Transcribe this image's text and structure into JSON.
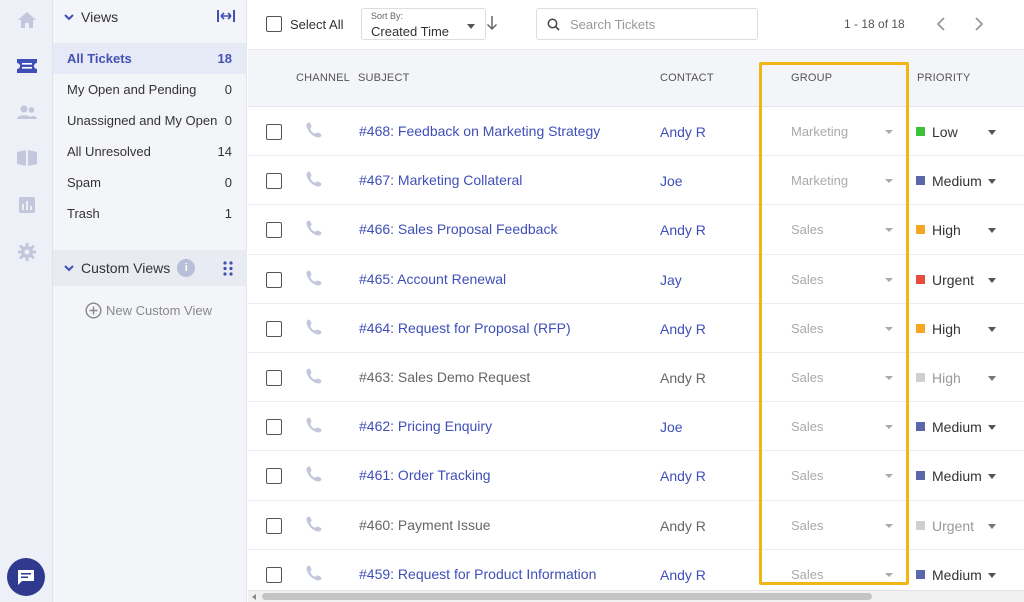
{
  "rail": {
    "icons": [
      "home-icon",
      "tickets-icon",
      "contacts-icon",
      "knowledge-base-icon",
      "reports-icon",
      "settings-icon"
    ],
    "active_icon": "tickets-icon",
    "active_color": "#3f4fb8",
    "inactive_color": "#c3c7dd",
    "chat_button_icon": "chat-icon"
  },
  "views": {
    "title": "Views",
    "items": [
      {
        "label": "All Tickets",
        "count": "18",
        "active": true
      },
      {
        "label": "My Open and Pending",
        "count": "0"
      },
      {
        "label": "Unassigned and My Open",
        "count": "0"
      },
      {
        "label": "All Unresolved",
        "count": "14"
      },
      {
        "label": "Spam",
        "count": "0"
      },
      {
        "label": "Trash",
        "count": "1"
      }
    ],
    "custom_views_title": "Custom Views",
    "info_badge": "i",
    "new_custom_view_label": "New Custom View"
  },
  "toolbar": {
    "select_all_label": "Select All",
    "sort_by_label": "Sort By:",
    "sort_value": "Created Time",
    "search_placeholder": "Search Tickets",
    "pagination": "1 - 18 of 18"
  },
  "table": {
    "columns": {
      "channel": "CHANNEL",
      "subject": "SUBJECT",
      "contact": "CONTACT",
      "group": "GROUP",
      "priority": "PRIORITY"
    },
    "rows": [
      {
        "subject": "#468: Feedback on Marketing Strategy",
        "contact": "Andy R",
        "group": "Marketing",
        "priority": "Low",
        "priority_color": "#3cc13b",
        "unread": true
      },
      {
        "subject": "#467: Marketing Collateral",
        "contact": "Joe",
        "group": "Marketing",
        "priority": "Medium",
        "priority_color": "#5b67a8",
        "unread": true
      },
      {
        "subject": "#466: Sales Proposal Feedback",
        "contact": "Andy R",
        "group": "Sales",
        "priority": "High",
        "priority_color": "#f5a623",
        "unread": true
      },
      {
        "subject": "#465: Account Renewal",
        "contact": "Jay",
        "group": "Sales",
        "priority": "Urgent",
        "priority_color": "#e84c3d",
        "unread": true
      },
      {
        "subject": "#464: Request for Proposal (RFP)",
        "contact": "Andy R",
        "group": "Sales",
        "priority": "High",
        "priority_color": "#f5a623",
        "unread": true
      },
      {
        "subject": "#463: Sales Demo Request",
        "contact": "Andy R",
        "group": "Sales",
        "priority": "High",
        "priority_color": "#cfcfcf",
        "unread": false
      },
      {
        "subject": "#462: Pricing Enquiry",
        "contact": "Joe",
        "group": "Sales",
        "priority": "Medium",
        "priority_color": "#5b67a8",
        "unread": true
      },
      {
        "subject": "#461: Order Tracking",
        "contact": "Andy R",
        "group": "Sales",
        "priority": "Medium",
        "priority_color": "#5b67a8",
        "unread": true
      },
      {
        "subject": "#460: Payment Issue",
        "contact": "Andy R",
        "group": "Sales",
        "priority": "Urgent",
        "priority_color": "#cfcfcf",
        "unread": false
      },
      {
        "subject": "#459: Request for Product Information",
        "contact": "Andy R",
        "group": "Sales",
        "priority": "Medium",
        "priority_color": "#5b67a8",
        "unread": true
      }
    ],
    "channel_icon": "phone-icon",
    "highlight_color": "#f2b516"
  }
}
